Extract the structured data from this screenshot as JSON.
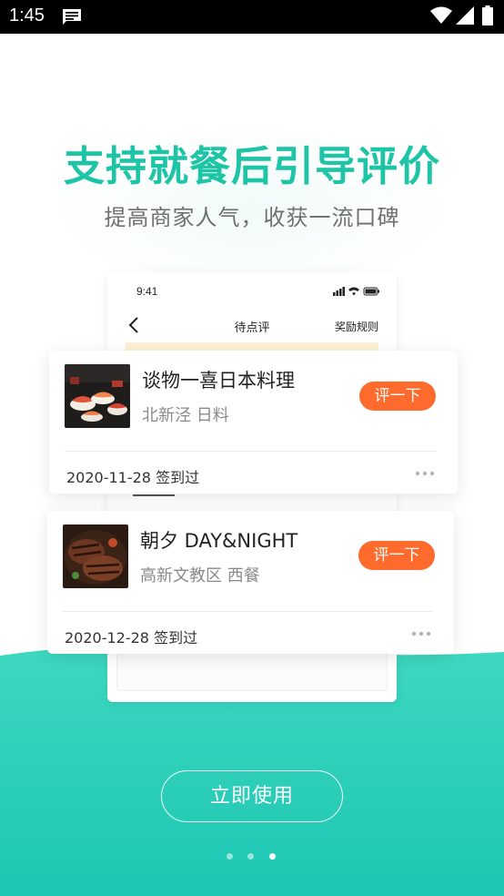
{
  "status_bar": {
    "time": "1:45"
  },
  "hero": {
    "headline": "支持就餐后引导评价",
    "subline": "提高商家人气，收获一流口碑",
    "headline_color": "#1ec4a6"
  },
  "phone_mock": {
    "time": "9:41",
    "title": "待点评",
    "rules": "奖励规则"
  },
  "cards": [
    {
      "name": "谈物一喜日本料理",
      "meta": "北新泾 日料",
      "button": "评一下",
      "date": "2020-11-28 签到过",
      "image_icon": "sushi-photo"
    },
    {
      "name": "朝夕 DAY&NIGHT",
      "meta": "高新文教区 西餐",
      "button": "评一下",
      "date": "2020-12-28 签到过",
      "image_icon": "steak-photo"
    }
  ],
  "cta": {
    "label": "立即使用"
  },
  "pager": {
    "count": 3,
    "active_index": 2
  },
  "colors": {
    "accent": "#1ec4a6",
    "button": "#ff6b2c"
  }
}
